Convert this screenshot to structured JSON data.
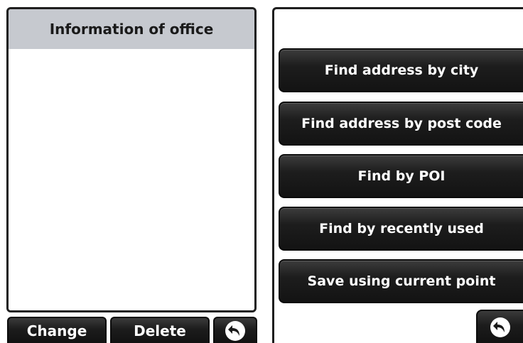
{
  "left_screen": {
    "title": "Information of office",
    "buttons": {
      "change": "Change",
      "delete": "Delete",
      "back_icon": "back-arrow-icon"
    }
  },
  "right_screen": {
    "menu": [
      "Find address by city",
      "Find address by post code",
      "Find by POI",
      "Find by recently used",
      "Save using current point"
    ],
    "back_icon": "back-arrow-icon"
  },
  "colors": {
    "button_dark": "#1c1c1c",
    "title_bar": "#c6c9cf",
    "border": "#1e1e1e",
    "text_light": "#ffffff"
  }
}
